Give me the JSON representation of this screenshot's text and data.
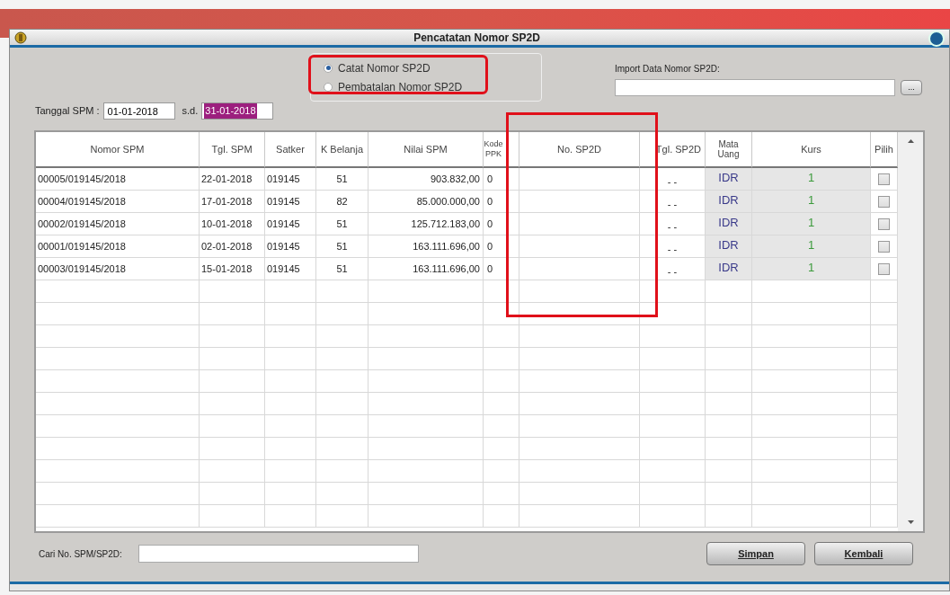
{
  "window": {
    "title": "Pencatatan Nomor SP2D"
  },
  "date_filter": {
    "label": "Tanggal SPM :",
    "from": "01-01-2018",
    "separator": "s.d.",
    "to": "31-01-2018"
  },
  "mode_options": [
    {
      "label": "Catat Nomor SP2D",
      "selected": true
    },
    {
      "label": "Pembatalan Nomor SP2D",
      "selected": false
    }
  ],
  "import": {
    "label": "Import Data Nomor SP2D:",
    "browse_button": "..."
  },
  "table": {
    "columns": [
      "Nomor SPM",
      "Tgl. SPM",
      "Satker",
      "K Belanja",
      "Nilai SPM",
      "Kode PPK",
      "No. SP2D",
      "Tgl. SP2D",
      "Mata Uang",
      "Kurs",
      "Pilih"
    ],
    "rows": [
      {
        "nomor_spm": "00005/019145/2018",
        "tgl_spm": "22-01-2018",
        "satker": "019145",
        "k_belanja": "51",
        "nilai_spm": "903.832,00",
        "kode_ppk": "0",
        "tgl_sp2d": "- -",
        "mata_uang": "IDR",
        "kurs": "1",
        "checked": false
      },
      {
        "nomor_spm": "00004/019145/2018",
        "tgl_spm": "17-01-2018",
        "satker": "019145",
        "k_belanja": "82",
        "nilai_spm": "85.000.000,00",
        "kode_ppk": "0",
        "tgl_sp2d": "- -",
        "mata_uang": "IDR",
        "kurs": "1",
        "checked": false
      },
      {
        "nomor_spm": "00002/019145/2018",
        "tgl_spm": "10-01-2018",
        "satker": "019145",
        "k_belanja": "51",
        "nilai_spm": "125.712.183,00",
        "kode_ppk": "0",
        "tgl_sp2d": "- -",
        "mata_uang": "IDR",
        "kurs": "1",
        "checked": false
      },
      {
        "nomor_spm": "00001/019145/2018",
        "tgl_spm": "02-01-2018",
        "satker": "019145",
        "k_belanja": "51",
        "nilai_spm": "163.111.696,00",
        "kode_ppk": "0",
        "tgl_sp2d": "- -",
        "mata_uang": "IDR",
        "kurs": "1",
        "checked": false
      },
      {
        "nomor_spm": "00003/019145/2018",
        "tgl_spm": "15-01-2018",
        "satker": "019145",
        "k_belanja": "51",
        "nilai_spm": "163.111.696,00",
        "kode_ppk": "0",
        "tgl_sp2d": "- -",
        "mata_uang": "IDR",
        "kurs": "1",
        "checked": false
      }
    ]
  },
  "search": {
    "label": "Cari No. SPM/SP2D:"
  },
  "buttons": [
    "Simpan",
    "Kembali"
  ]
}
